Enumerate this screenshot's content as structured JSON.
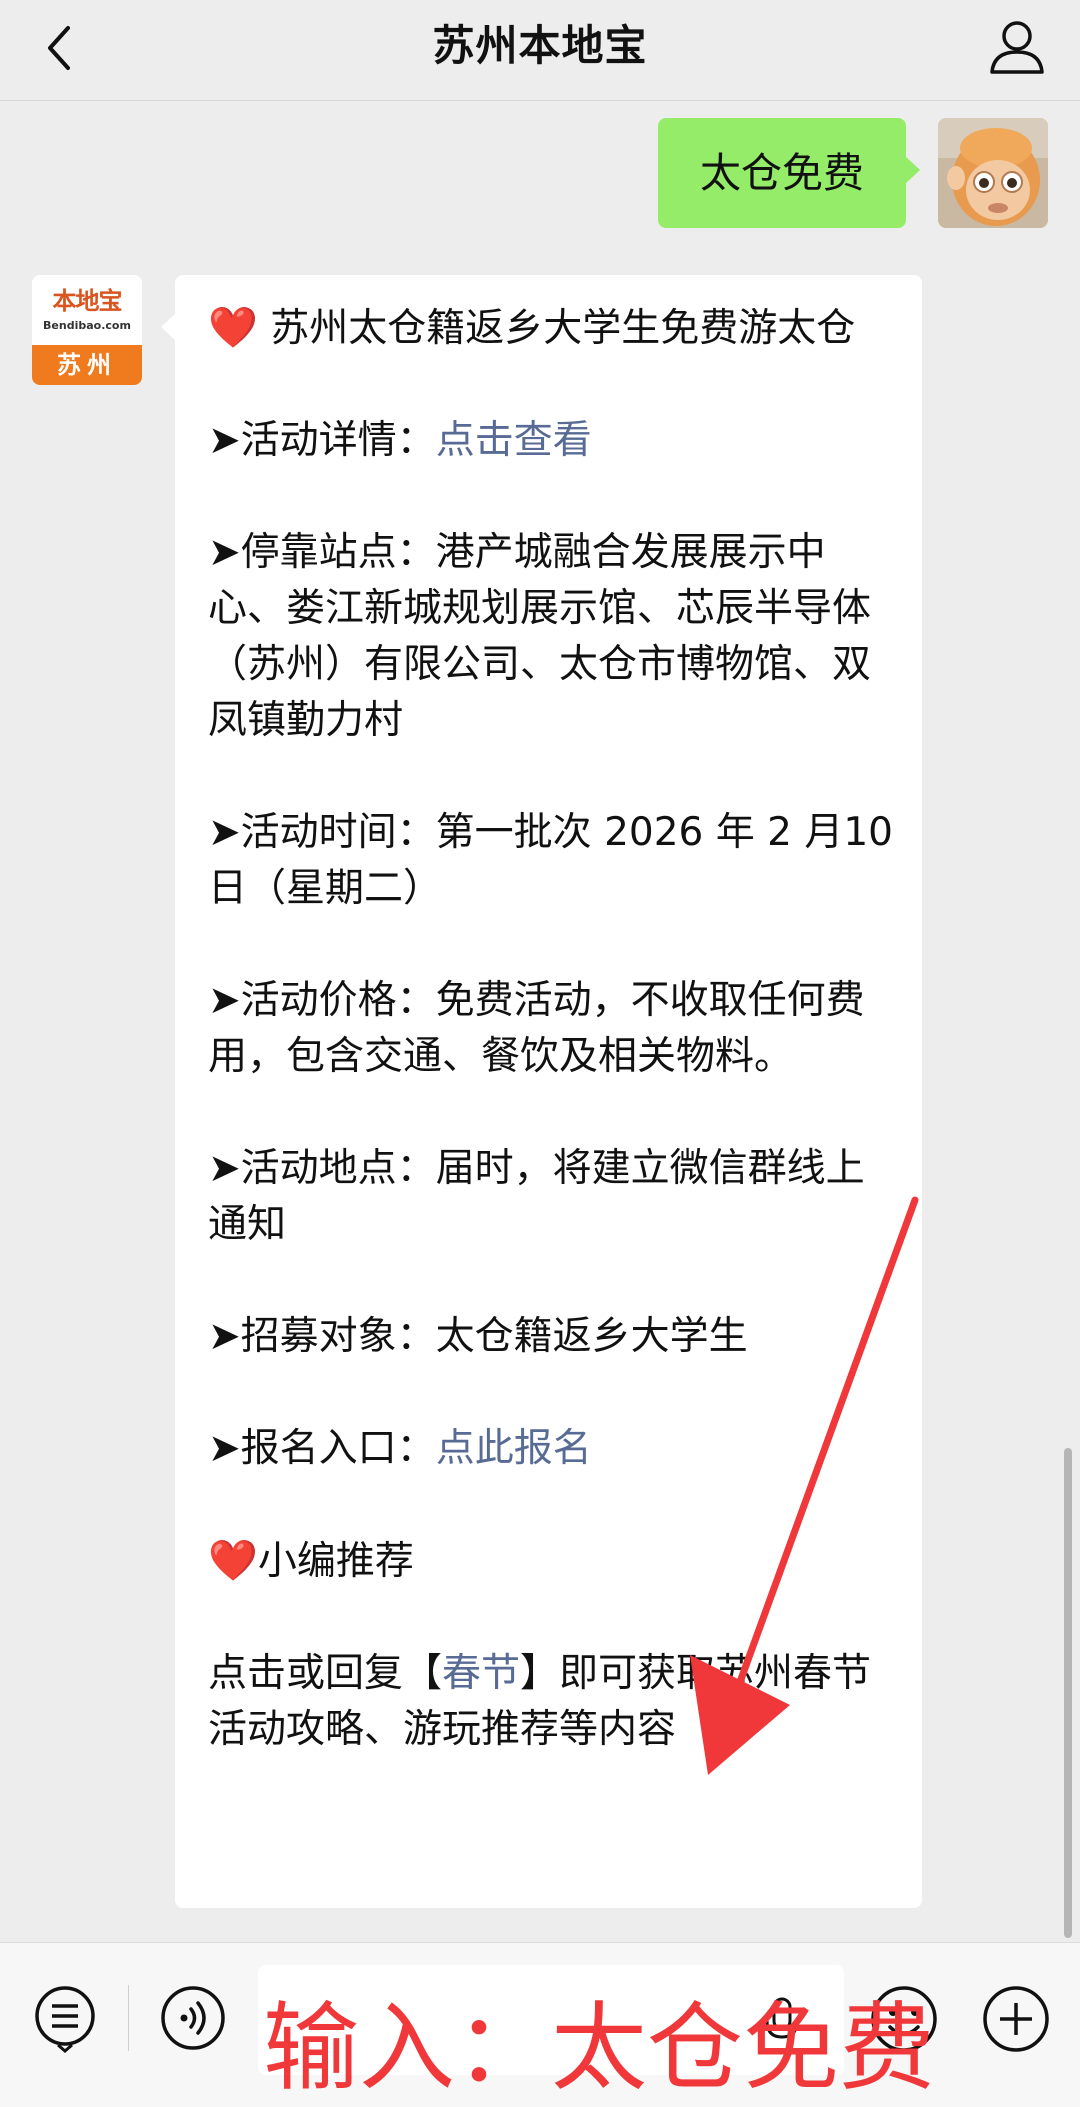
{
  "header": {
    "title": "苏州本地宝"
  },
  "outgoing": {
    "text": "太仓免费"
  },
  "brand_avatar": {
    "logo_text": "本地宝",
    "logo_url": "Bendibao.com",
    "city": "苏州"
  },
  "message": {
    "heading": "苏州太仓籍返乡大学生免费游太仓",
    "detail_label": "➤活动详情：",
    "detail_link": "点击查看",
    "stops": "➤停靠站点：港产城融合发展展示中心、娄江新城规划展示馆、芯辰半导体（苏州）有限公司、太仓市博物馆、双凤镇勤力村",
    "time": "➤活动时间：第一批次 2026 年 2 月10日（星期二）",
    "price": "➤活动价格：免费活动，不收取任何费用，包含交通、餐饮及相关物料。",
    "location": "➤活动地点：届时，将建立微信群线上通知",
    "target": "➤招募对象：太仓籍返乡大学生",
    "signup_label": "➤报名入口：",
    "signup_link": "点此报名",
    "recommend": "小编推荐",
    "footer_pre": "点击或回复【",
    "footer_link": "春节",
    "footer_post": "】即可获取苏州春节活动攻略、游玩推荐等内容"
  },
  "annotation": {
    "text": "输入：太仓免费"
  },
  "icons": {
    "back": "chevron-left-icon",
    "profile": "user-icon",
    "menu": "menu-list-icon",
    "voice": "voice-icon",
    "emoji": "emoji-icon",
    "plus": "plus-icon"
  },
  "colors": {
    "outgoing_bubble": "#95ec69",
    "link": "#576b95",
    "heart": "#e0282e",
    "annotation": "#f0383a",
    "brand_orange": "#f07a1e"
  }
}
